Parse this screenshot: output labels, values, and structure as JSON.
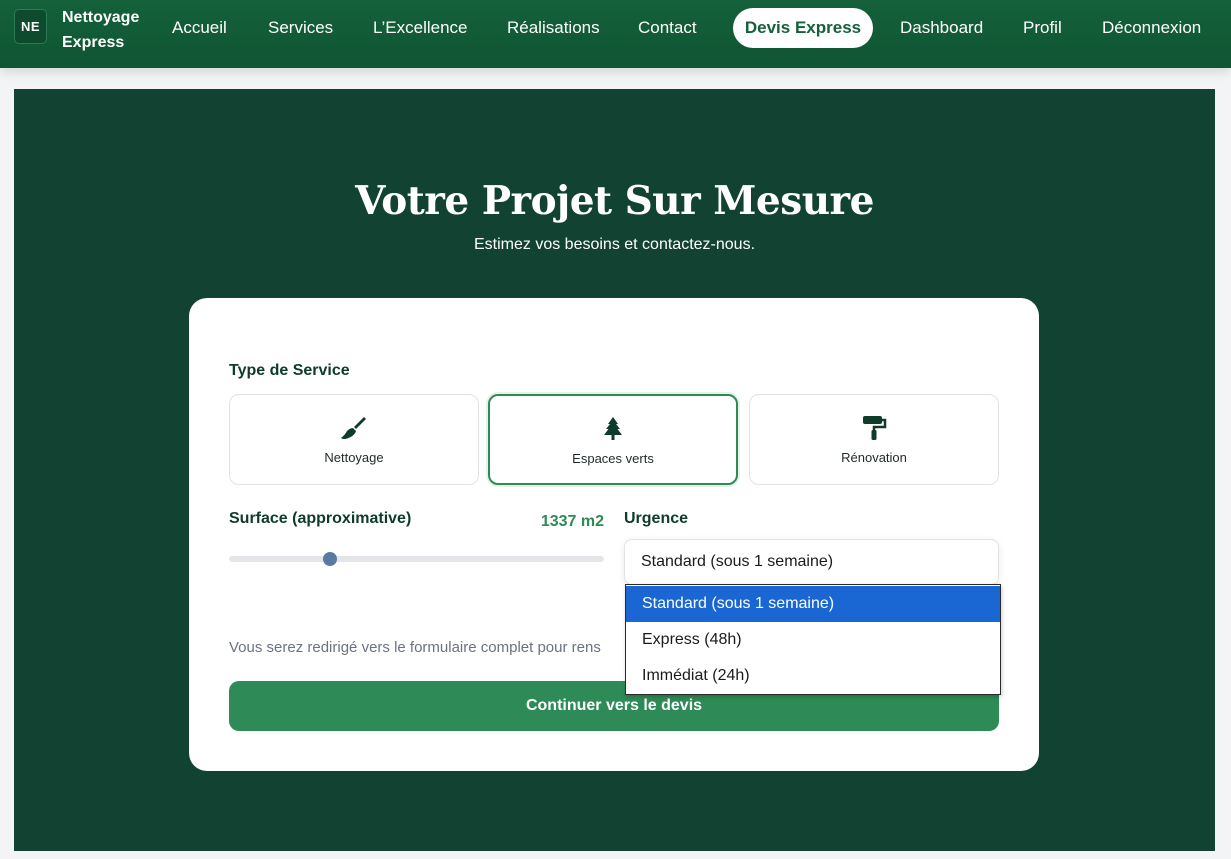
{
  "navbar": {
    "logo_text": "NE",
    "brand_line1": "Nettoyage",
    "brand_line2": "Express",
    "items": [
      {
        "label": "Accueil"
      },
      {
        "label": "Services"
      },
      {
        "label": "L’Excellence"
      },
      {
        "label": "Réalisations"
      },
      {
        "label": "Contact"
      },
      {
        "label": "Devis Express",
        "active": true
      },
      {
        "label": "Dashboard"
      },
      {
        "label": "Profil"
      },
      {
        "label": "Déconnexion"
      }
    ]
  },
  "hero": {
    "title": "Votre Projet Sur Mesure",
    "subtitle": "Estimez vos besoins et contactez-nous."
  },
  "form": {
    "service_type_label": "Type de Service",
    "services": [
      {
        "label": "Nettoyage",
        "icon": "broom-icon",
        "selected": false
      },
      {
        "label": "Espaces verts",
        "icon": "tree-icon",
        "selected": true
      },
      {
        "label": "Rénovation",
        "icon": "paint-roller-icon",
        "selected": false
      }
    ],
    "surface_label": "Surface (approximative)",
    "surface_value": "1337 m2",
    "surface_fraction": 0.27,
    "urgency_label": "Urgence",
    "urgency_selected": "Standard (sous 1 semaine)",
    "urgency_options": [
      {
        "label": "Standard (sous 1 semaine)",
        "highlighted": true
      },
      {
        "label": "Express (48h)",
        "highlighted": false
      },
      {
        "label": "Immédiat (24h)",
        "highlighted": false
      }
    ],
    "note": "Vous serez redirigé vers le formulaire complet pour rens",
    "submit_label": "Continuer vers le devis"
  },
  "colors": {
    "nav_bg": "#14613a",
    "hero_bg": "#124232",
    "accent": "#2e8b57",
    "highlight": "#1a66d3"
  }
}
